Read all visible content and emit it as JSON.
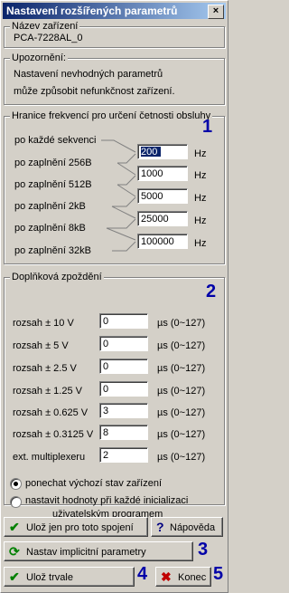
{
  "window": {
    "title": "Nastavení rozšířených parametrů"
  },
  "device": {
    "legend": "Název zařízení",
    "value": "PCA-7228AL_0"
  },
  "warning": {
    "legend": "Upozornění:",
    "line1": "Nastavení nevhodných parametrů",
    "line2": "může způsobit nefunkčnost zařízení."
  },
  "frequency": {
    "legend": "Hranice frekvencí pro určení četnosti obsluhy",
    "marker": "1",
    "labels": [
      "po každé sekvenci",
      "po zaplnění 256B",
      "po zaplnění 512B",
      "po zaplnění 2kB",
      "po zaplnění 8kB",
      "po zaplnění 32kB"
    ],
    "values": [
      "200",
      "1000",
      "5000",
      "25000",
      "100000"
    ],
    "unit": "Hz"
  },
  "delays": {
    "legend": "Doplňková zpoždění",
    "marker": "2",
    "unit": "µs (0~127)",
    "rows": [
      {
        "label": "rozsah ± 10 V",
        "value": "0"
      },
      {
        "label": "rozsah ± 5 V",
        "value": "0"
      },
      {
        "label": "rozsah ± 2.5 V",
        "value": "0"
      },
      {
        "label": "rozsah ± 1.25 V",
        "value": "0"
      },
      {
        "label": "rozsah ± 0.625 V",
        "value": "3"
      },
      {
        "label": "rozsah ± 0.3125 V",
        "value": "8"
      },
      {
        "label": "ext. multiplexeru",
        "value": "2"
      }
    ],
    "radio1": "ponechat výchozí stav zařízení",
    "radio2_line1": "nastavit hodnoty při každé inicializaci",
    "radio2_line2": "uživatelským programem"
  },
  "buttons": {
    "save_once": "Ulož jen pro toto spojení",
    "help": "Nápověda",
    "defaults": "Nastav implicitní parametry",
    "save_permanent": "Ulož trvale",
    "end": "Konec",
    "marker3": "3",
    "marker4": "4",
    "marker5": "5"
  },
  "colors": {
    "check": "#008000",
    "cross": "#c00000",
    "help": "#000080",
    "marker": "#0000a8"
  },
  "icons": {
    "save_once": "green-check-icon",
    "help": "question-mark-icon",
    "defaults": "green-refresh-icon",
    "save_permanent": "green-check-icon",
    "end": "red-cross-icon"
  }
}
